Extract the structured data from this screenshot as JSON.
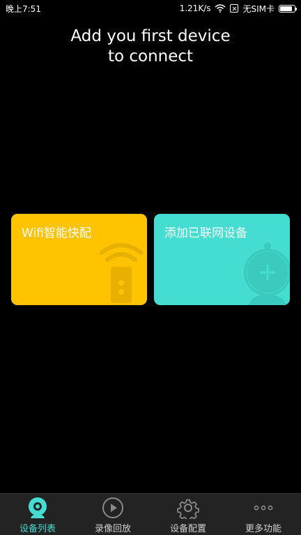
{
  "status_bar": {
    "time": "晚上7:51",
    "speed": "1.21K/s",
    "sim": "无SIM卡",
    "battery_level": 0.9
  },
  "title": {
    "line1": "Add you first device",
    "line2": "to connect"
  },
  "cards": {
    "wifi_config": {
      "label": "Wifi智能快配",
      "color": "#ffc300"
    },
    "add_connected": {
      "label": "添加已联网设备",
      "color": "#45ddd2"
    }
  },
  "bottom_nav": {
    "items": [
      {
        "label": "设备列表",
        "icon": "camera-icon",
        "active": true
      },
      {
        "label": "录像回放",
        "icon": "play-icon",
        "active": false
      },
      {
        "label": "设备配置",
        "icon": "gear-icon",
        "active": false
      },
      {
        "label": "更多功能",
        "icon": "more-icon",
        "active": false
      }
    ],
    "accent": "#45ddd2"
  }
}
